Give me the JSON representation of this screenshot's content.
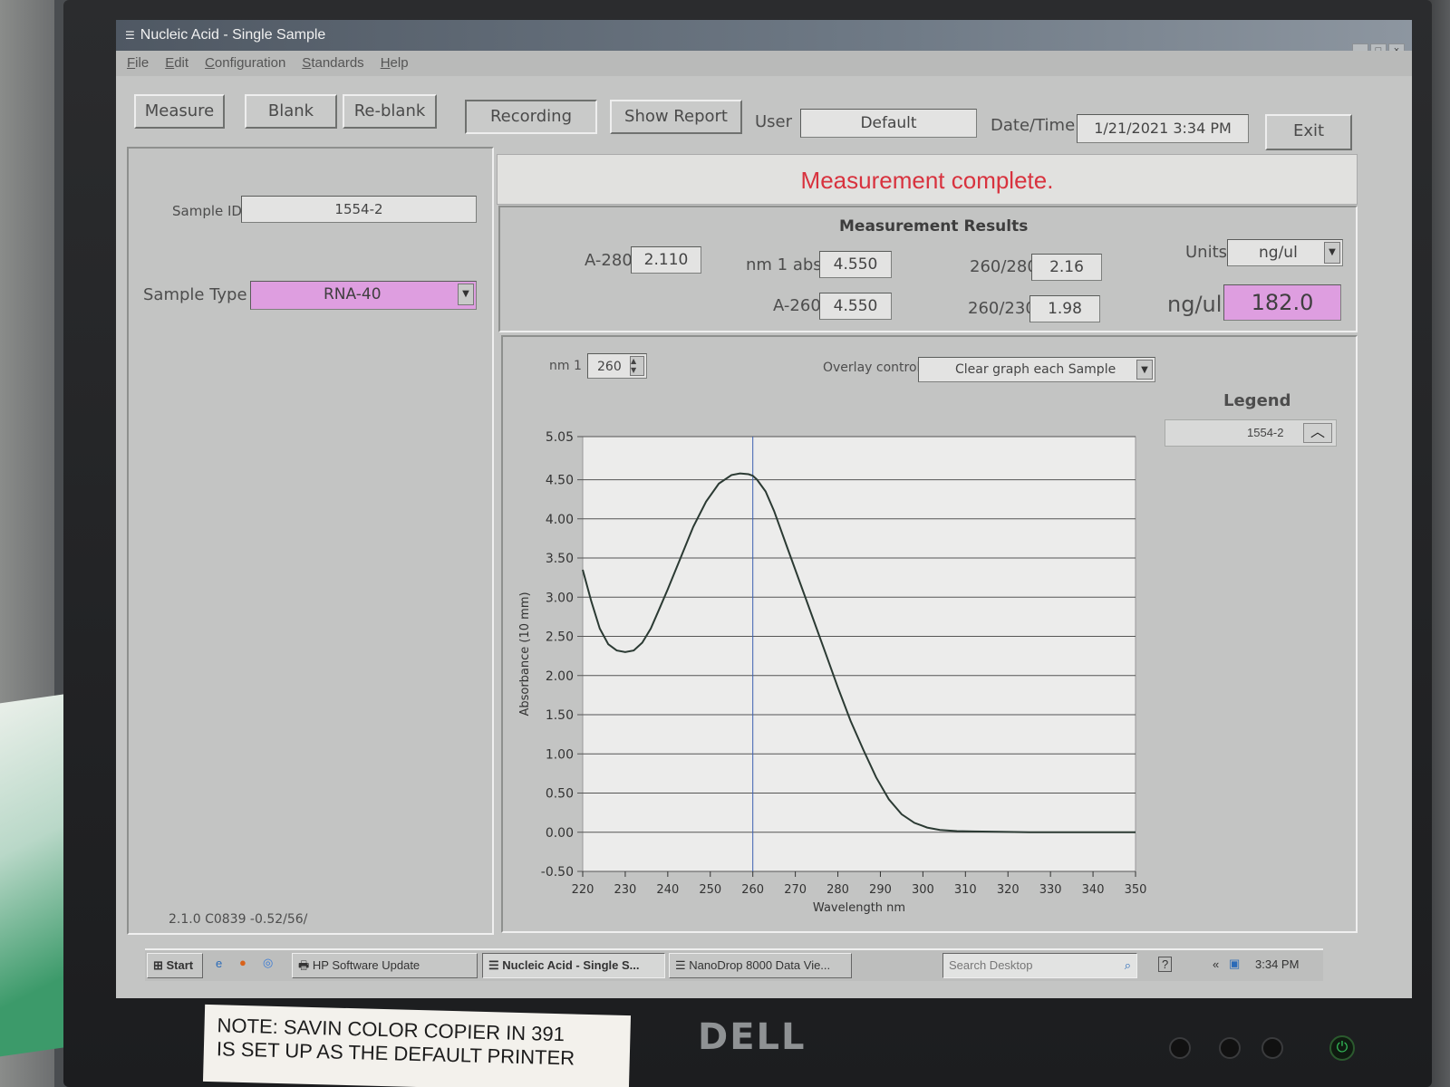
{
  "window": {
    "title": "Nucleic Acid - Single Sample",
    "menu": [
      "File",
      "Edit",
      "Configuration",
      "Standards",
      "Help"
    ]
  },
  "toolbar": {
    "measure": "Measure",
    "blank": "Blank",
    "reblank": "Re-blank",
    "recording": "Recording",
    "show_report": "Show Report",
    "user_label": "User",
    "user_value": "Default",
    "datetime_label": "Date/Time",
    "datetime_value": "1/21/2021  3:34 PM",
    "exit": "Exit"
  },
  "sample": {
    "id_label": "Sample ID",
    "id_value": "1554-2",
    "type_label": "Sample Type",
    "type_value": "RNA-40",
    "version": "2.1.0 C0839 -0.52/56/"
  },
  "status_message": "Measurement complete.",
  "results": {
    "title": "Measurement Results",
    "a280_label": "A-280",
    "a280": "2.110",
    "nm1abs_label": "nm 1 abs.",
    "nm1abs": "4.550",
    "a260_label": "A-260",
    "a260": "4.550",
    "r260_280_label": "260/280",
    "r260_280": "2.16",
    "r260_230_label": "260/230",
    "r260_230": "1.98",
    "units_label": "Units",
    "units_value": "ng/ul",
    "conc_label": "ng/ul",
    "conc_value": "182.0"
  },
  "graph_controls": {
    "nm1_label": "nm 1",
    "nm1_value": "260",
    "overlay_label": "Overlay control",
    "overlay_value": "Clear graph each Sample",
    "legend_title": "Legend",
    "legend_entry": "1554-2"
  },
  "chart_data": {
    "type": "line",
    "xlabel": "Wavelength nm",
    "ylabel": "Absorbance (10 mm)",
    "xlim": [
      220,
      350
    ],
    "ylim": [
      -0.5,
      5.05
    ],
    "x_ticks": [
      "220",
      "230",
      "240",
      "250",
      "260",
      "270",
      "280",
      "290",
      "300",
      "310",
      "320",
      "330",
      "340",
      "350"
    ],
    "y_ticks": [
      "5.05",
      "4.50",
      "4.00",
      "3.50",
      "3.00",
      "2.50",
      "2.00",
      "1.50",
      "1.00",
      "0.50",
      "0.00",
      "-0.50"
    ],
    "y_tick_values": [
      5.05,
      4.5,
      4.0,
      3.5,
      3.0,
      2.5,
      2.0,
      1.5,
      1.0,
      0.5,
      0.0,
      -0.5
    ],
    "cursor_x": 260,
    "series": [
      {
        "name": "1554-2",
        "color": "#2b3a33",
        "x": [
          220,
          222,
          224,
          226,
          228,
          230,
          232,
          234,
          236,
          238,
          240,
          243,
          246,
          249,
          252,
          255,
          257,
          259,
          260,
          261,
          263,
          265,
          268,
          271,
          274,
          277,
          280,
          283,
          286,
          289,
          292,
          295,
          298,
          301,
          304,
          308,
          312,
          318,
          325,
          335,
          350
        ],
        "y": [
          3.35,
          2.95,
          2.6,
          2.4,
          2.32,
          2.3,
          2.32,
          2.42,
          2.6,
          2.85,
          3.1,
          3.5,
          3.9,
          4.22,
          4.45,
          4.56,
          4.58,
          4.57,
          4.55,
          4.5,
          4.35,
          4.1,
          3.65,
          3.2,
          2.75,
          2.3,
          1.85,
          1.42,
          1.05,
          0.7,
          0.42,
          0.23,
          0.12,
          0.06,
          0.03,
          0.015,
          0.01,
          0.005,
          0.0,
          0.0,
          0.0
        ]
      }
    ]
  },
  "taskbar": {
    "start": "Start",
    "items": [
      "HP Software Update",
      "Nucleic Acid - Single S...",
      "NanoDrop 8000 Data Vie..."
    ],
    "search_placeholder": "Search Desktop",
    "clock": "3:34 PM"
  },
  "monitor": {
    "brand": "DELL",
    "note_line1": "NOTE: SAVIN COLOR COPIER IN 391",
    "note_line2": "IS SET UP AS THE DEFAULT PRINTER"
  }
}
